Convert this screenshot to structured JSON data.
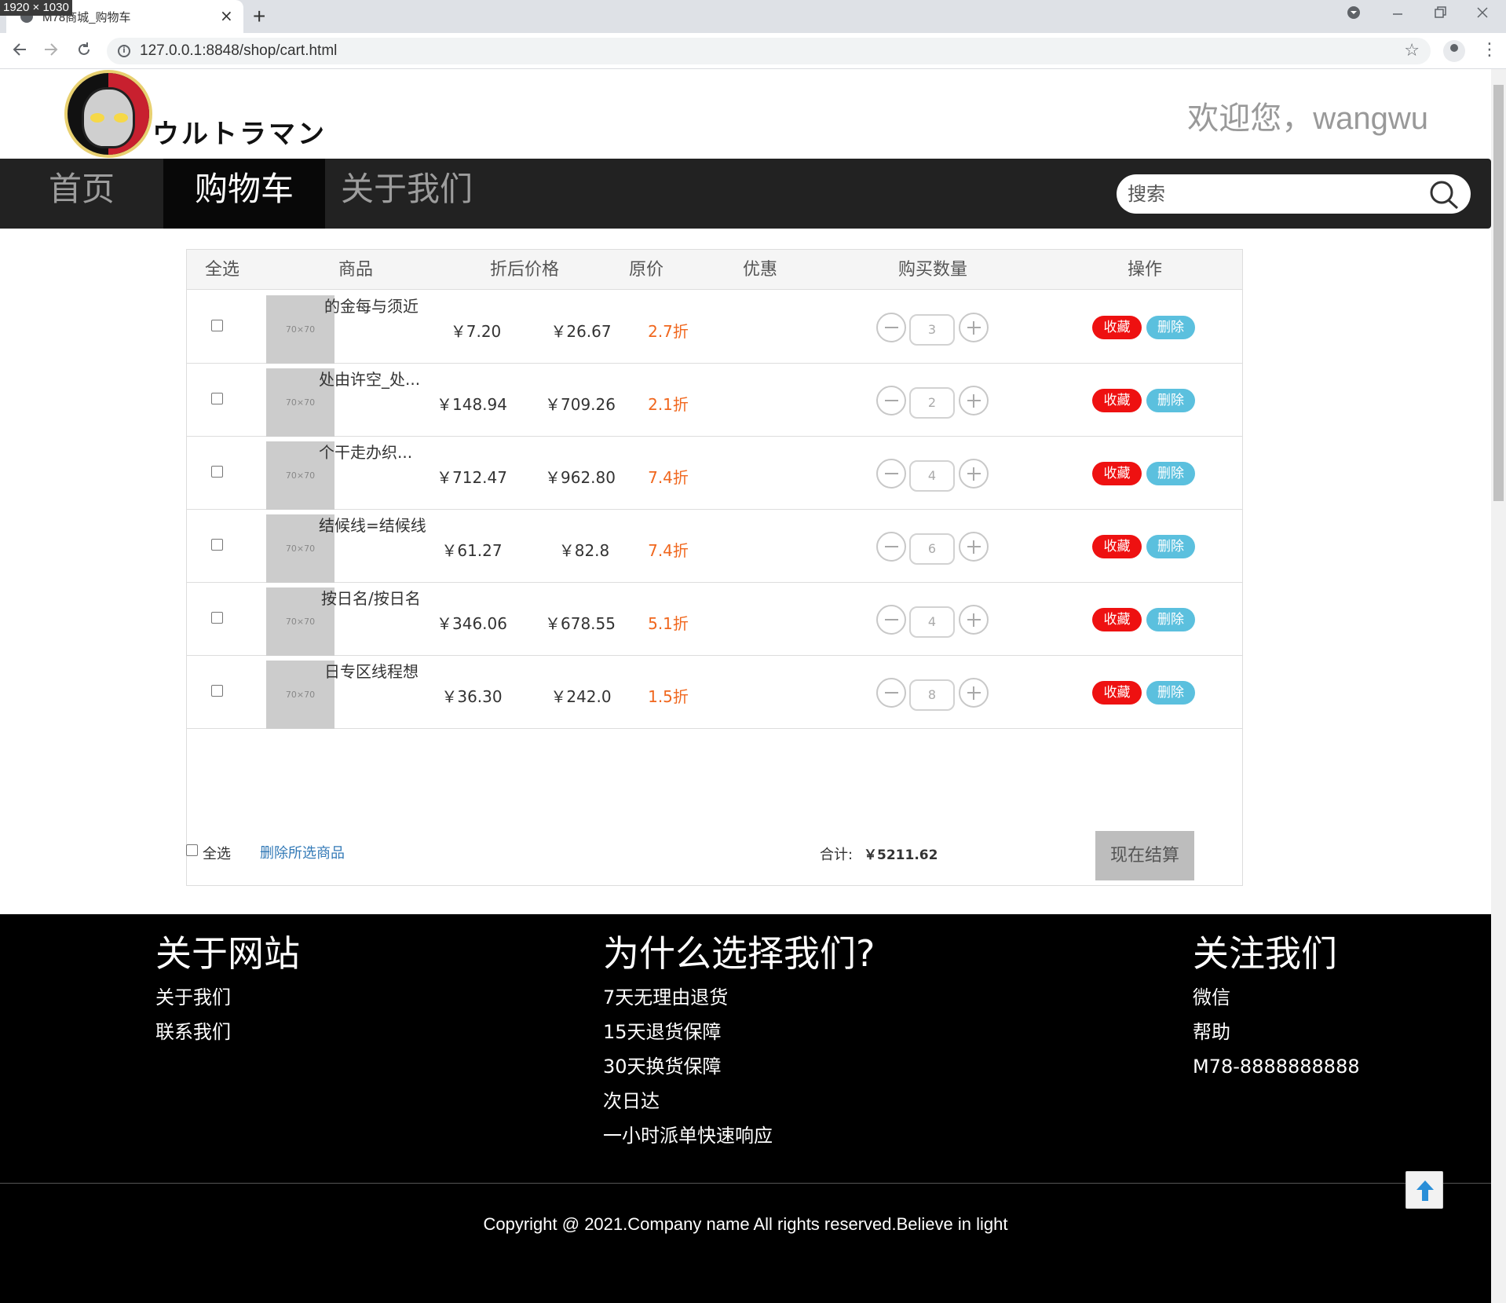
{
  "dim_badge": "1920 × 1030",
  "browser": {
    "tab_title": "M78商城_购物车",
    "tab_close": "×",
    "new_tab": "+",
    "url": "127.0.0.1:8848/shop/cart.html"
  },
  "header": {
    "logo_text": "ウルトラマン",
    "welcome": "欢迎您，wangwu"
  },
  "nav": {
    "items": [
      "首页",
      "购物车",
      "关于我们"
    ],
    "active": "购物车",
    "search_placeholder": "搜索"
  },
  "cart": {
    "columns": [
      "全选",
      "商品",
      "折后价格",
      "原价",
      "优惠",
      "购买数量",
      "操作"
    ],
    "thumb_label": "70×70",
    "fav_label": "收藏",
    "del_label": "删除",
    "rows": [
      {
        "name": "的金每与须近",
        "price": "￥7.20",
        "original": "￥26.67",
        "discount": "2.7折",
        "qty": "3"
      },
      {
        "name": "处由许空_处...",
        "price": "￥148.94",
        "original": "￥709.26",
        "discount": "2.1折",
        "qty": "2"
      },
      {
        "name": "个干走办织...",
        "price": "￥712.47",
        "original": "￥962.80",
        "discount": "7.4折",
        "qty": "4"
      },
      {
        "name": "结候线=结候线",
        "price": "￥61.27",
        "original": "￥82.8",
        "discount": "7.4折",
        "qty": "6"
      },
      {
        "name": "按日名/按日名",
        "price": "￥346.06",
        "original": "￥678.55",
        "discount": "5.1折",
        "qty": "4"
      },
      {
        "name": "日专区线程想",
        "price": "￥36.30",
        "original": "￥242.0",
        "discount": "1.5折",
        "qty": "8"
      }
    ],
    "footer": {
      "select_all": "全选",
      "delete_selected": "删除所选商品",
      "total_label": "合计:",
      "total_value": "￥5211.62",
      "checkout": "现在结算"
    }
  },
  "site_footer": {
    "columns": [
      {
        "title": "关于网站",
        "items": [
          "关于我们",
          "联系我们"
        ]
      },
      {
        "title": "为什么选择我们?",
        "items": [
          "7天无理由退货",
          "15天退货保障",
          "30天换货保障",
          "次日达",
          "一小时派单快速响应"
        ]
      },
      {
        "title": "关注我们",
        "items": [
          "微信",
          "帮助",
          "M78-8888888888"
        ]
      }
    ],
    "copyright": "Copyright @ 2021.Company name All rights reserved.Believe in light"
  },
  "colors": {
    "nav_bg": "#222222",
    "nav_active_bg": "#080808",
    "discount": "#f0671e",
    "fav_button": "#ee1111",
    "delete_button": "#5bc0de",
    "link": "#337ab7",
    "footer_bg": "#000000"
  }
}
